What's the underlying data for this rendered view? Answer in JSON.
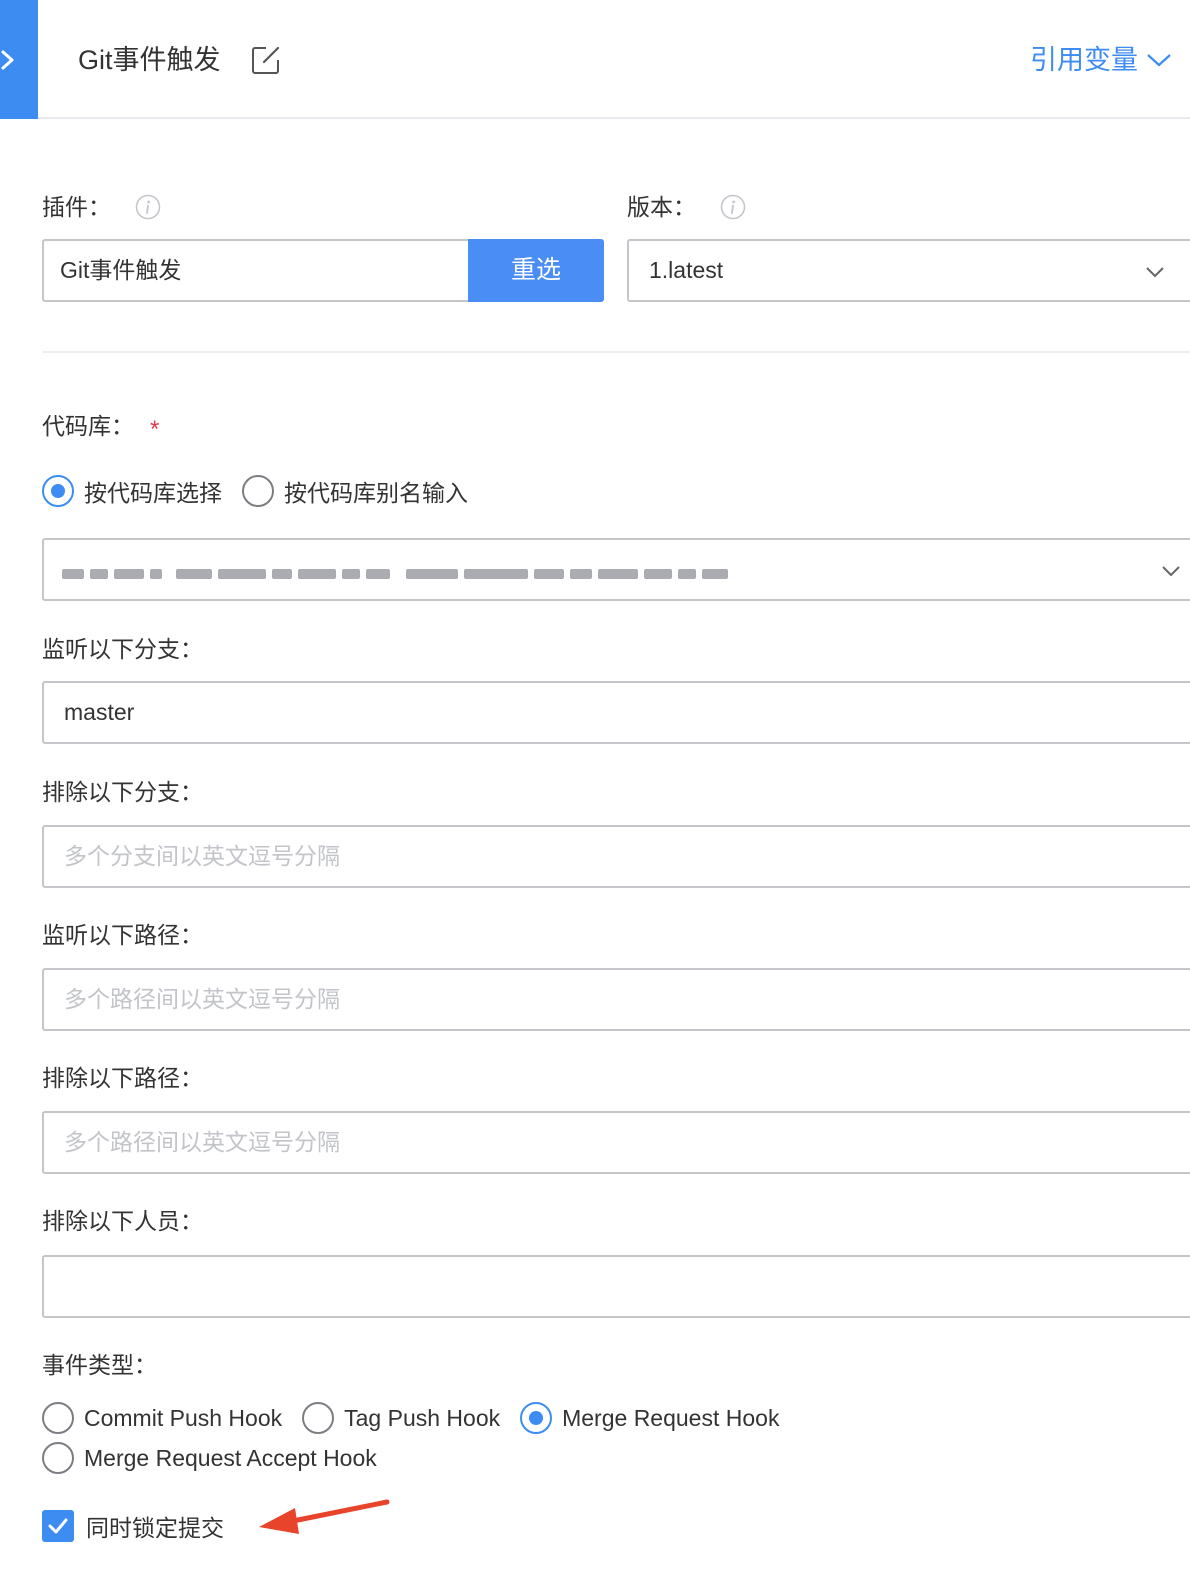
{
  "header": {
    "title": "Git事件触发",
    "ref_vars_label": "引用变量"
  },
  "plugin": {
    "label": "插件",
    "value": "Git事件触发",
    "reselect_label": "重选"
  },
  "version": {
    "label": "版本",
    "value": "1.latest"
  },
  "repo": {
    "label": "代码库",
    "mode_options": [
      "按代码库选择",
      "按代码库别名输入"
    ],
    "mode_selected": "按代码库选择"
  },
  "branch_include": {
    "label": "监听以下分支",
    "value": "master"
  },
  "branch_exclude": {
    "label": "排除以下分支",
    "placeholder": "多个分支间以英文逗号分隔"
  },
  "path_include": {
    "label": "监听以下路径",
    "placeholder": "多个路径间以英文逗号分隔"
  },
  "path_exclude": {
    "label": "排除以下路径",
    "placeholder": "多个路径间以英文逗号分隔"
  },
  "user_exclude": {
    "label": "排除以下人员"
  },
  "event_type": {
    "label": "事件类型",
    "options": [
      "Commit Push Hook",
      "Tag Push Hook",
      "Merge Request Hook",
      "Merge Request Accept Hook"
    ],
    "selected": "Merge Request Hook"
  },
  "lock_commit": {
    "label": "同时锁定提交",
    "checked": true
  },
  "colors": {
    "accent": "#3c8cf2",
    "button": "#4a8df5",
    "border": "#c4c6cc",
    "required": "#e0384b",
    "annotation_arrow": "#e8442c"
  },
  "icons": {
    "collapse": "chevron-right-icon",
    "edit": "edit-icon",
    "info": "info-icon",
    "dropdown": "chevron-down-icon",
    "check": "check-icon"
  }
}
